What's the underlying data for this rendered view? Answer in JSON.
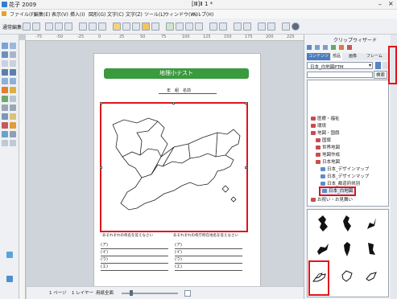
{
  "app": {
    "title": "花子 2009",
    "doc_title": "[Ⅲ]Ⅱ 1 *"
  },
  "menu": [
    "ファイル(F)",
    "編集(E)",
    "表示(V)",
    "挿入(I)",
    "図形(G)",
    "文字(C)",
    "文字(Z)",
    "ツール(L)",
    "ウィンドウ(W)",
    "ヘルプ(H)"
  ],
  "toolbar": {
    "mode_label": "通常編集"
  },
  "ruler_labels": [
    "-75",
    "-50",
    "-25",
    "0",
    "25",
    "50",
    "75",
    "100",
    "125",
    "150",
    "175",
    "200",
    "225"
  ],
  "panel": {
    "title": "クリップウィザード",
    "tabs": [
      "コンテンツ",
      "部品",
      "画像",
      "フレーム"
    ],
    "category_value": "日本_白地図PTM",
    "search_label": "検索",
    "tree": [
      {
        "label": "医療・福祉",
        "indent": 0
      },
      {
        "label": "環境",
        "indent": 0
      },
      {
        "label": "地図・国旗",
        "indent": 0
      },
      {
        "label": "国旗",
        "indent": 1
      },
      {
        "label": "世界地図",
        "indent": 1
      },
      {
        "label": "地図作成",
        "indent": 1
      },
      {
        "label": "日本地図",
        "indent": 1
      },
      {
        "label": "日本_デザインマップ",
        "indent": 2
      },
      {
        "label": "日本_デザインマップ",
        "indent": 2
      },
      {
        "label": "日本_都道府県別",
        "indent": 2
      },
      {
        "label": "日本_白地図",
        "indent": 2,
        "selected": true
      },
      {
        "label": "お祝い・お見舞い",
        "indent": 0
      }
    ]
  },
  "document": {
    "title": "地理小テスト",
    "name_line": "年　組　名前",
    "caption_left": "あそれぞれの県名を答えなさい",
    "caption_right": "あそれぞれの県庁所在地名を答えなさい",
    "answers_left": [
      "(ア)",
      "(イ)",
      "(ウ)",
      "(エ)"
    ],
    "answers_right": [
      "(ア)",
      "(イ)",
      "(ウ)",
      "(エ)"
    ]
  },
  "statusbar": {
    "page_info": "1 ページ",
    "layer_info": "1 レイヤー",
    "zoom_label": "用紙全面"
  },
  "colors": {
    "highlight": "#e0141c",
    "title_green": "#3a9a3e"
  }
}
